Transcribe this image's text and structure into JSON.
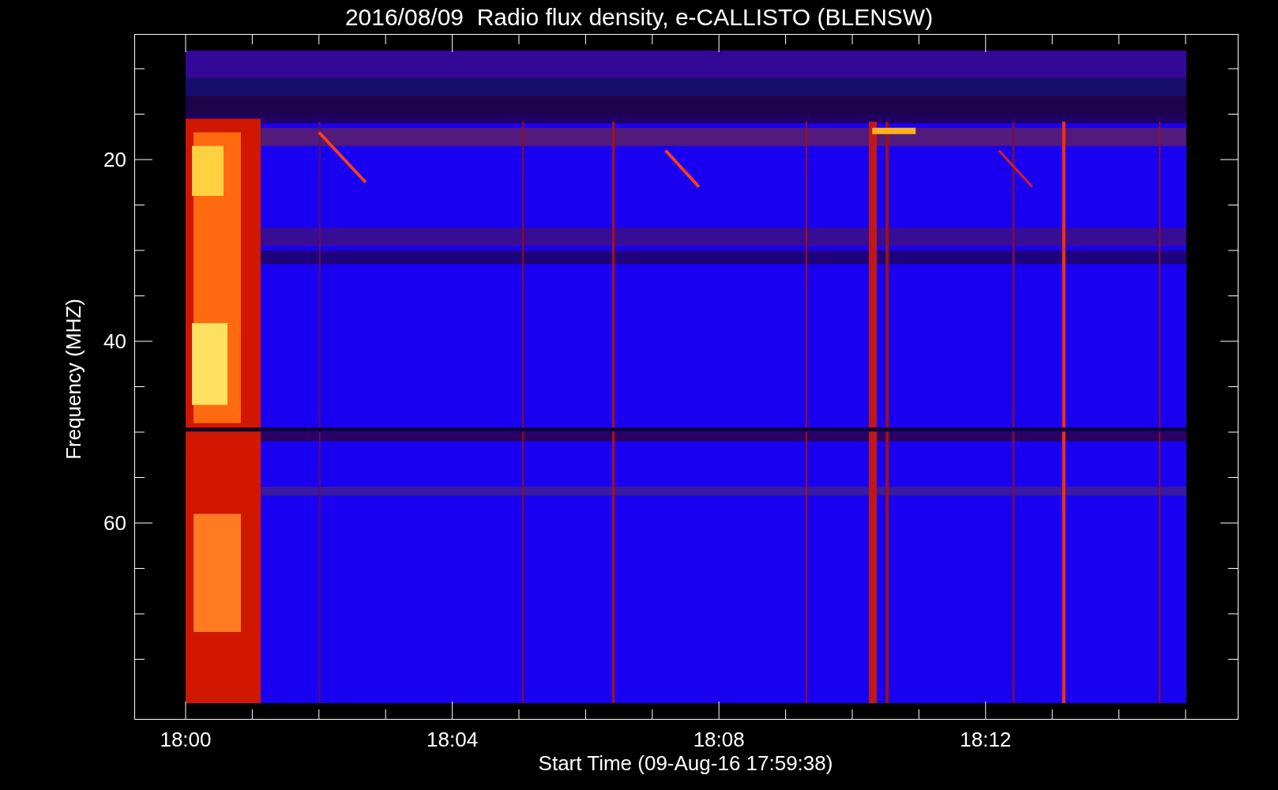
{
  "title": "2016/08/09  Radio flux density, e-CALLISTO (BLENSW)",
  "y_axis": {
    "label": "Frequency (MHZ)",
    "ticks": [
      "20",
      "40",
      "60"
    ]
  },
  "x_axis": {
    "label": "Start Time (09-Aug-16 17:59:38)",
    "ticks": [
      "18:00",
      "18:04",
      "18:08",
      "18:12"
    ]
  }
}
